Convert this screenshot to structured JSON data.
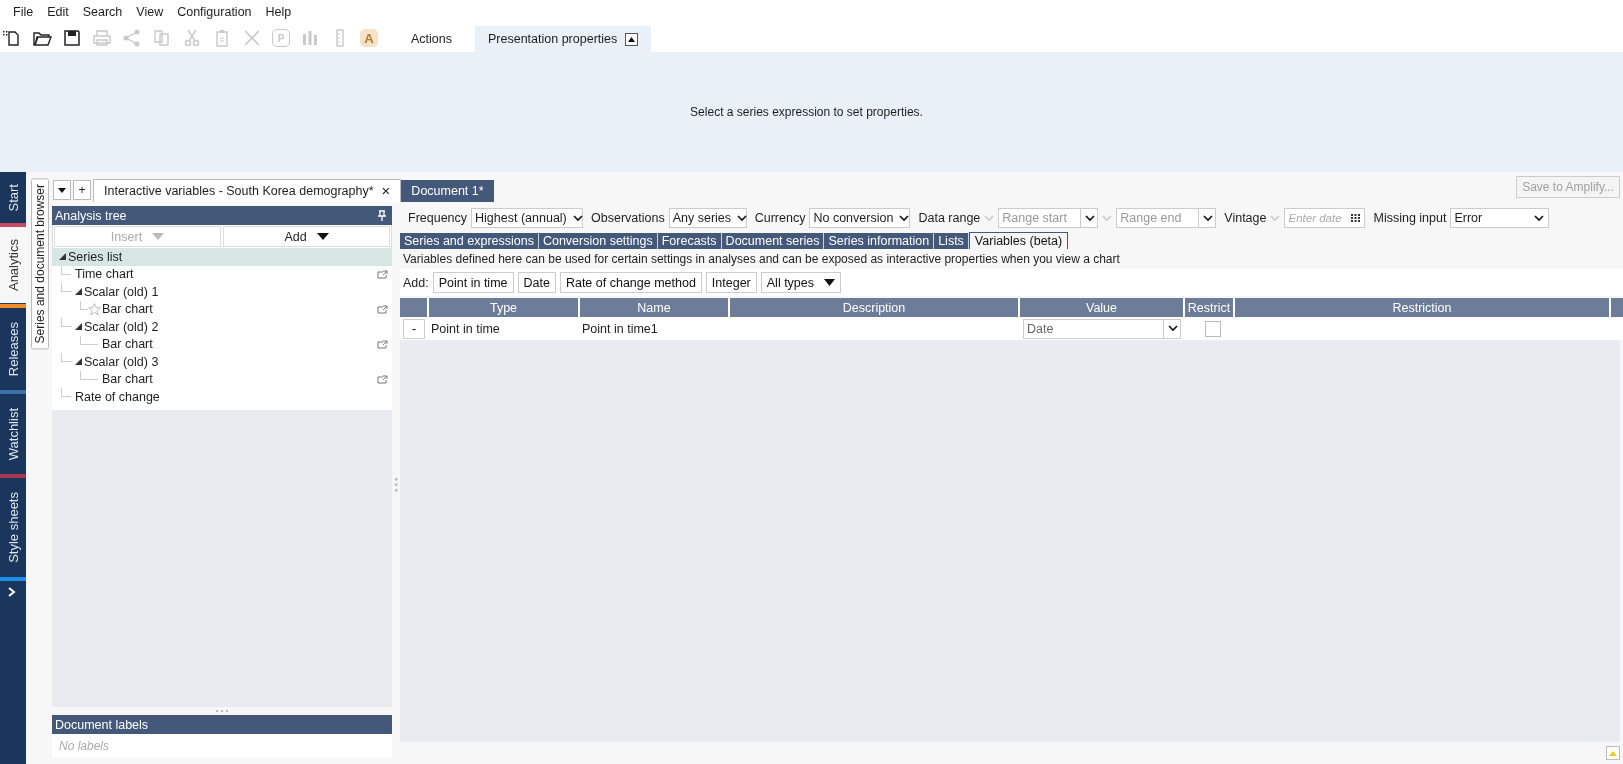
{
  "menu": [
    "File",
    "Edit",
    "Search",
    "View",
    "Configuration",
    "Help"
  ],
  "toolbar": {
    "buttons": [
      {
        "kind": "new",
        "disabled": false
      },
      {
        "kind": "open",
        "disabled": false
      },
      {
        "kind": "save",
        "disabled": false
      },
      {
        "kind": "print",
        "disabled": true
      },
      {
        "kind": "share",
        "disabled": true
      },
      {
        "kind": "copy",
        "disabled": true
      },
      {
        "kind": "cut",
        "disabled": true
      },
      {
        "kind": "paste",
        "disabled": true
      },
      {
        "kind": "delete",
        "disabled": true
      },
      {
        "kind": "letter",
        "glyph": "P",
        "disabled": true
      },
      {
        "kind": "chart",
        "disabled": true
      },
      {
        "kind": "ruler",
        "disabled": true
      },
      {
        "kind": "letter",
        "glyph": "A",
        "disabled": true
      }
    ],
    "tabs": [
      {
        "label": "Actions",
        "selected": false
      },
      {
        "label": "Presentation properties",
        "selected": true
      }
    ]
  },
  "presentation_panel": {
    "message": "Select a series expression to set properties."
  },
  "nav": [
    {
      "label": "Start",
      "selected": false,
      "color": "#c44d63"
    },
    {
      "label": "Analytics",
      "selected": true,
      "color": "#f28c28"
    },
    {
      "label": "Releases",
      "selected": false,
      "color": "#3f6fa8"
    },
    {
      "label": "Watchlist",
      "selected": false,
      "color": "#a8384f"
    },
    {
      "label": "Style sheets",
      "selected": false,
      "color": "#1e8ff0"
    }
  ],
  "side_tab": "Series and document browser",
  "document_tabs": {
    "new_tab": "+",
    "tabs": [
      {
        "label": "Interactive variables - South Korea demography*",
        "selected": true,
        "close": "×"
      },
      {
        "label": "Document 1*",
        "selected": false
      }
    ]
  },
  "save_button": {
    "label": "Save to Amplify...",
    "disabled": true
  },
  "analysis_tree": {
    "title": "Analysis tree",
    "insert": {
      "label": "Insert",
      "disabled": true
    },
    "add": {
      "label": "Add",
      "disabled": false
    },
    "items": [
      {
        "label": "Series list",
        "selected": true,
        "expanded": true,
        "link": false,
        "star": false,
        "children": [
          {
            "label": "Time chart",
            "selected": false,
            "link": true,
            "star": false
          },
          {
            "label": "Scalar (old) 1",
            "selected": false,
            "expanded": true,
            "link": false,
            "star": false,
            "children": [
              {
                "label": "Bar chart",
                "selected": false,
                "link": true,
                "star": true
              }
            ]
          },
          {
            "label": "Scalar (old) 2",
            "selected": false,
            "expanded": true,
            "link": false,
            "star": false,
            "children": [
              {
                "label": "Bar chart",
                "selected": false,
                "link": true,
                "star": false
              }
            ]
          },
          {
            "label": "Scalar (old) 3",
            "selected": false,
            "expanded": true,
            "link": false,
            "star": false,
            "children": [
              {
                "label": "Bar chart",
                "selected": false,
                "link": true,
                "star": false
              }
            ]
          },
          {
            "label": "Rate of change",
            "selected": false,
            "link": false,
            "star": false
          }
        ]
      }
    ]
  },
  "document_labels": {
    "title": "Document labels",
    "empty_text": "No labels"
  },
  "filters": [
    {
      "kind": "select",
      "label": "Frequency",
      "value": "Highest (annual)"
    },
    {
      "kind": "select",
      "label": "Observations",
      "value": "Any series"
    },
    {
      "kind": "select",
      "label": "Currency",
      "value": "No conversion"
    },
    {
      "kind": "range",
      "label": "Data range",
      "start_placeholder": "Range start",
      "end_placeholder": "Range end"
    },
    {
      "kind": "date",
      "label": "Vintage",
      "placeholder": "Enter date"
    },
    {
      "kind": "select",
      "label": "Missing input",
      "value": "Error"
    }
  ],
  "content_tabs": [
    {
      "label": "Series and expressions",
      "selected": false
    },
    {
      "label": "Conversion settings",
      "selected": false
    },
    {
      "label": "Forecasts",
      "selected": false
    },
    {
      "label": "Document series",
      "selected": false
    },
    {
      "label": "Series information",
      "selected": false
    },
    {
      "label": "Lists",
      "selected": false
    },
    {
      "label": "Variables (beta)",
      "selected": true
    }
  ],
  "description": "Variables defined here can be used for certain settings in analyses and can be exposed as interactive properties when you view a chart",
  "add_bar": {
    "label": "Add:",
    "buttons": [
      "Point in time",
      "Date",
      "Rate of change method",
      "Integer"
    ],
    "type_filter": "All types"
  },
  "table": {
    "columns": [
      "Type",
      "Name",
      "Description",
      "Value",
      "Restrict",
      "Restriction"
    ],
    "rows": [
      {
        "remove": "-",
        "type": "Point in time",
        "name": "Point in time1",
        "value_placeholder": "Date",
        "restrict": false
      }
    ]
  }
}
